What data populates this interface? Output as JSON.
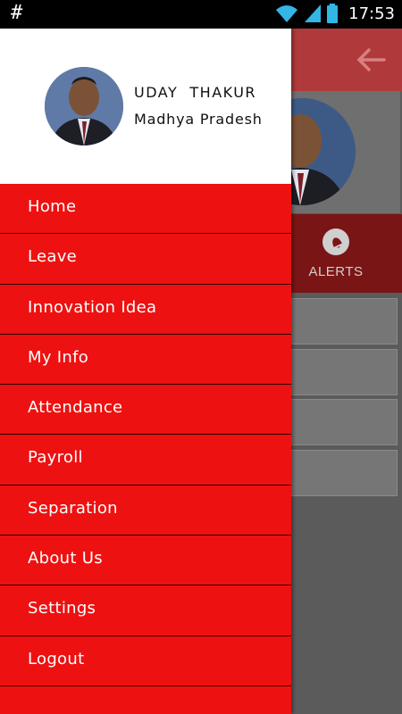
{
  "status_bar": {
    "left_glyph": "#",
    "time": "17:53",
    "icons": [
      "wifi-icon",
      "signal-icon",
      "battery-icon"
    ]
  },
  "background_app": {
    "tab_alerts_label": "ALERTS",
    "appbar_color": "#b0393b"
  },
  "drawer": {
    "user": {
      "name": "UDAY  THAKUR",
      "region": "Madhya Pradesh"
    },
    "accent_color": "#ee1111",
    "items": [
      {
        "label": "Home"
      },
      {
        "label": "Leave"
      },
      {
        "label": "Innovation Idea"
      },
      {
        "label": "My Info"
      },
      {
        "label": "Attendance"
      },
      {
        "label": "Payroll"
      },
      {
        "label": "Separation"
      },
      {
        "label": "About Us"
      },
      {
        "label": "Settings"
      },
      {
        "label": "Logout"
      }
    ]
  }
}
